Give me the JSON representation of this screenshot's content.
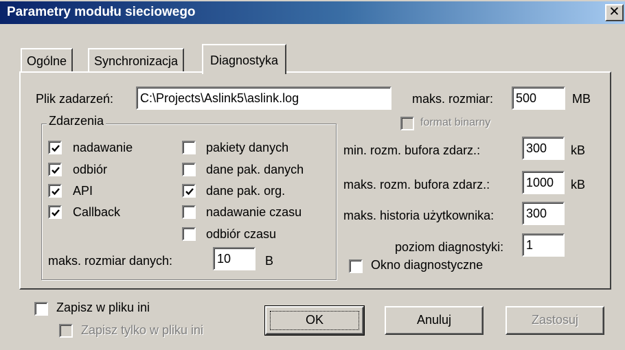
{
  "window": {
    "title": "Parametry modułu sieciowego",
    "close_glyph": "✕"
  },
  "tabs": [
    {
      "label": "Ogólne"
    },
    {
      "label": "Synchronizacja"
    },
    {
      "label": "Diagnostyka",
      "selected": true
    }
  ],
  "diagnostics": {
    "log_file_label": "Plik zadarzeń:",
    "log_file_value": "C:\\Projects\\Aslink5\\aslink.log",
    "max_size_label": "maks. rozmiar:",
    "max_size_value": "500",
    "max_size_unit": "MB",
    "binary_format_label": "format binarny",
    "binary_format_checked": false,
    "binary_format_enabled": false,
    "events_group": {
      "legend": "Zdarzenia",
      "left_items": [
        {
          "label": "nadawanie",
          "checked": true
        },
        {
          "label": "odbiór",
          "checked": true
        },
        {
          "label": "API",
          "checked": true
        },
        {
          "label": "Callback",
          "checked": true
        }
      ],
      "right_items": [
        {
          "label": "pakiety danych",
          "checked": false
        },
        {
          "label": "dane pak. danych",
          "checked": false
        },
        {
          "label": "dane pak. org.",
          "checked": true
        },
        {
          "label": "nadawanie czasu",
          "checked": false
        },
        {
          "label": "odbiór czasu",
          "checked": false
        }
      ],
      "max_data_size_label": "maks. rozmiar danych:",
      "max_data_size_value": "10",
      "max_data_size_unit": "B"
    },
    "min_buffer_label": "min. rozm. bufora zdarz.:",
    "min_buffer_value": "300",
    "min_buffer_unit": "kB",
    "max_buffer_label": "maks. rozm. bufora zdarz.:",
    "max_buffer_value": "1000",
    "max_buffer_unit": "kB",
    "max_history_label": "maks. historia użytkownika:",
    "max_history_value": "300",
    "diag_level_label": "poziom diagnostyki:",
    "diag_level_value": "1",
    "diag_window_label": "Okno diagnostyczne",
    "diag_window_checked": false
  },
  "footer": {
    "save_ini_label": "Zapisz w pliku ini",
    "save_ini_checked": false,
    "save_only_ini_label": "Zapisz tylko w pliku ini",
    "save_only_ini_checked": false,
    "save_only_ini_enabled": false,
    "ok_label": "OK",
    "cancel_label": "Anuluj",
    "apply_label": "Zastosuj",
    "apply_enabled": false
  }
}
